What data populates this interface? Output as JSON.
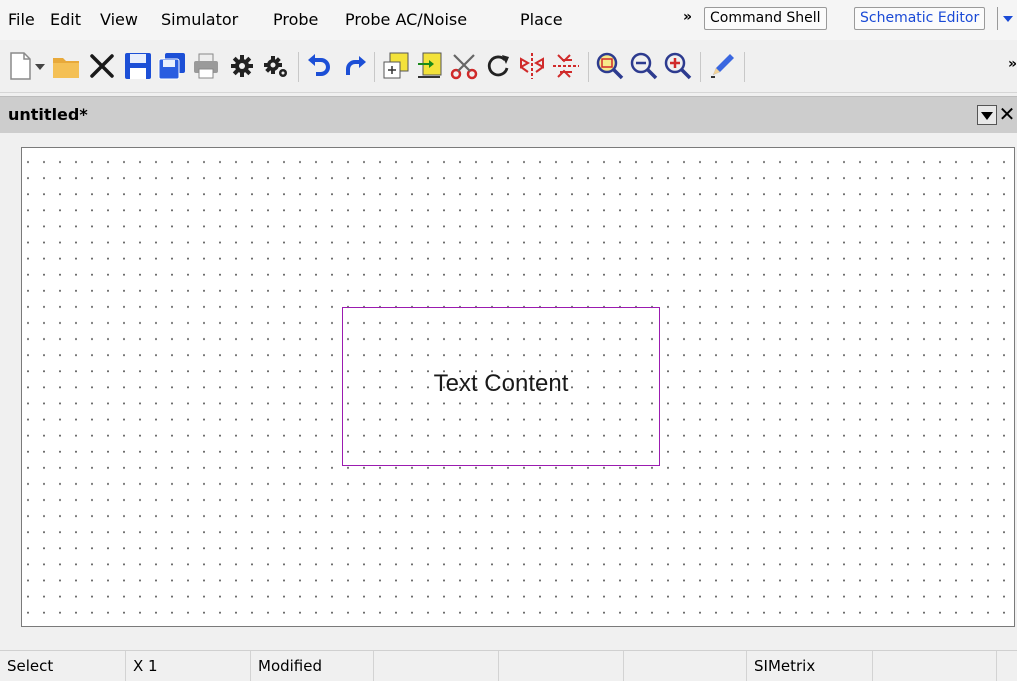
{
  "menu": {
    "items": [
      "File",
      "Edit",
      "View",
      "Simulator",
      "Probe",
      "Probe AC/Noise",
      "Place"
    ],
    "overflow": "»"
  },
  "modes": {
    "command_shell": "Command Shell",
    "schematic_editor": "Schematic Editor"
  },
  "toolbar": {
    "overflow": "»",
    "buttons": [
      "new-icon",
      "new-dropdown-icon",
      "open-folder-icon",
      "close-icon",
      "save-icon",
      "save-all-icon",
      "print-icon",
      "gear-icon",
      "gear-multi-icon",
      "undo-icon",
      "redo-icon",
      "place-component-icon",
      "place-port-icon",
      "scissors-icon",
      "rotate-icon",
      "mirror-vertical-icon",
      "mirror-horizontal-icon",
      "zoom-fit-icon",
      "zoom-out-icon",
      "zoom-in-icon",
      "pencil-icon"
    ]
  },
  "document": {
    "title": "untitled*"
  },
  "canvas": {
    "text_box_label": "Text Content",
    "colors": {
      "box_border": "#9b1bb0",
      "grid_dot": "#6e6e6e"
    }
  },
  "status": {
    "cells": [
      "Select",
      "X 1",
      "Modified",
      "",
      "",
      "",
      "SIMetrix",
      "",
      ""
    ]
  }
}
